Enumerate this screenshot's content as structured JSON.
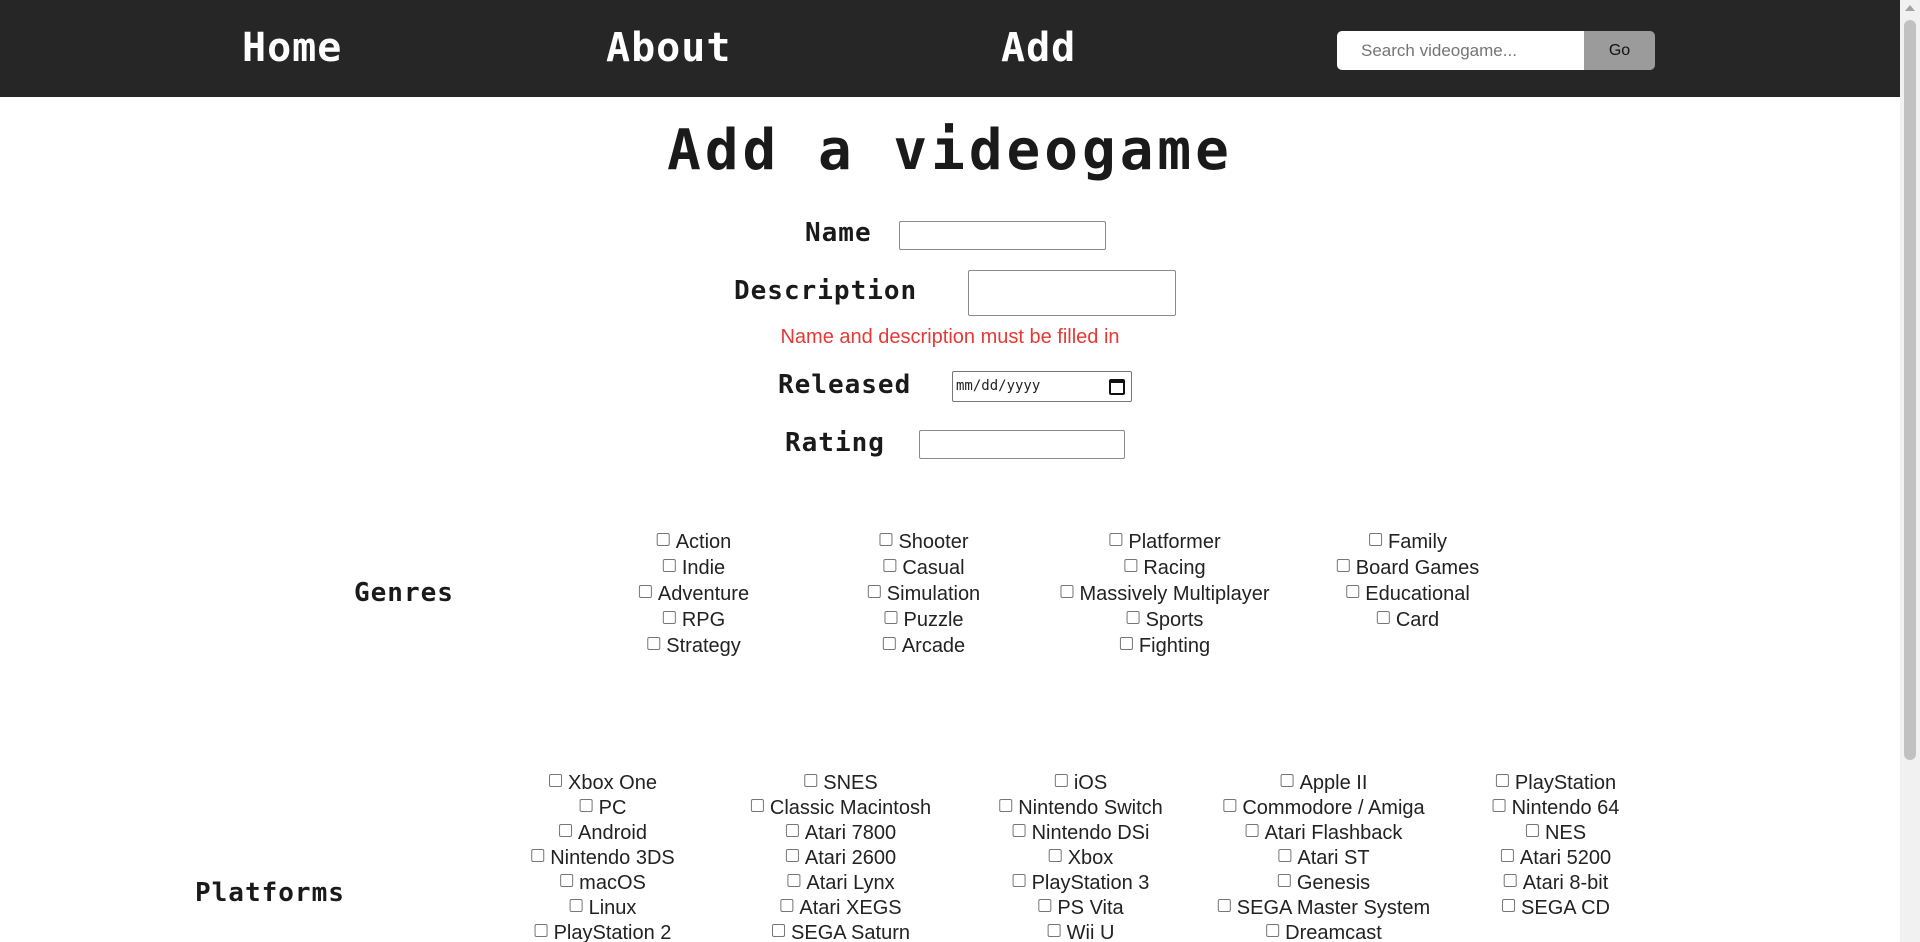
{
  "nav": {
    "home": "Home",
    "about": "About",
    "add": "Add",
    "search_placeholder": "Search videogame...",
    "go": "Go"
  },
  "title": "Add a videogame",
  "form": {
    "name_label": "Name",
    "description_label": "Description",
    "error": "Name and description must be filled in",
    "released_label": "Released",
    "released_placeholder": "mm/dd/yyyy",
    "rating_label": "Rating"
  },
  "genres": {
    "label": "Genres",
    "columns": [
      [
        "Action",
        "Indie",
        "Adventure",
        "RPG",
        "Strategy"
      ],
      [
        "Shooter",
        "Casual",
        "Simulation",
        "Puzzle",
        "Arcade"
      ],
      [
        "Platformer",
        "Racing",
        "Massively Multiplayer",
        "Sports",
        "Fighting"
      ],
      [
        "Family",
        "Board Games",
        "Educational",
        "Card"
      ]
    ]
  },
  "platforms": {
    "label": "Platforms",
    "columns": [
      [
        "Xbox One",
        "PC",
        "Android",
        "Nintendo 3DS",
        "macOS",
        "Linux",
        "PlayStation 2"
      ],
      [
        "SNES",
        "Classic Macintosh",
        "Atari 7800",
        "Atari 2600",
        "Atari Lynx",
        "Atari XEGS",
        "SEGA Saturn"
      ],
      [
        "iOS",
        "Nintendo Switch",
        "Nintendo DSi",
        "Xbox",
        "PlayStation 3",
        "PS Vita",
        "Wii U"
      ],
      [
        "Apple II",
        "Commodore / Amiga",
        "Atari Flashback",
        "Atari ST",
        "Genesis",
        "SEGA Master System",
        "Dreamcast"
      ],
      [
        "PlayStation",
        "Nintendo 64",
        "NES",
        "Atari 5200",
        "Atari 8-bit",
        "SEGA CD"
      ]
    ]
  }
}
